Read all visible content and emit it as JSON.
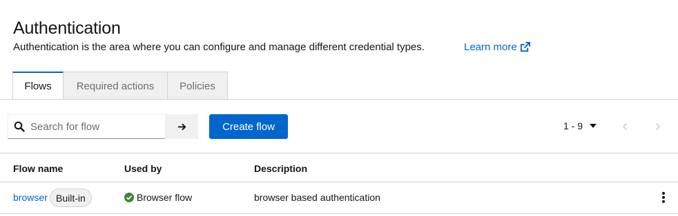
{
  "header": {
    "title": "Authentication",
    "description": "Authentication is the area where you can configure and manage different credential types.",
    "learn_more": "Learn more",
    "learn_more_icon": "external-link-icon"
  },
  "tabs": [
    {
      "label": "Flows",
      "active": true
    },
    {
      "label": "Required actions",
      "active": false
    },
    {
      "label": "Policies",
      "active": false
    }
  ],
  "toolbar": {
    "search_placeholder": "Search for flow",
    "search_value": "",
    "create_label": "Create flow",
    "pagination": "1 - 9"
  },
  "table": {
    "columns": [
      "Flow name",
      "Used by",
      "Description"
    ],
    "rows": [
      {
        "name": "browser",
        "badge": "Built-in",
        "used_by": "Browser flow",
        "used_by_icon": "check-circle-icon",
        "description": "browser based authentication"
      }
    ]
  },
  "colors": {
    "accent": "#0066cc",
    "success": "#3e8635",
    "border": "#d2d2d2"
  }
}
